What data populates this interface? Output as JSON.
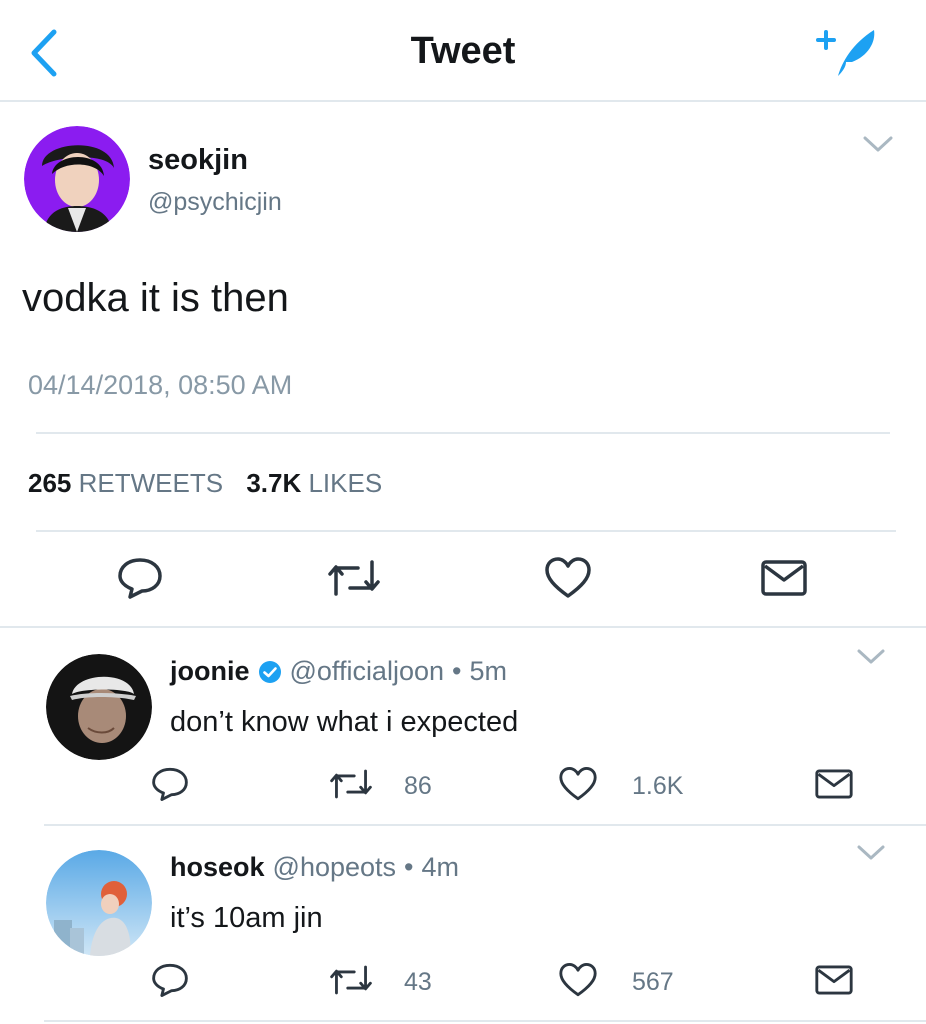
{
  "header": {
    "title": "Tweet",
    "back_icon": "chevron-left-icon",
    "compose_icon": "compose-tweet-icon"
  },
  "colors": {
    "accent": "#1da1f2",
    "text": "#14171a",
    "muted": "#657786",
    "divider": "#e1e8ed",
    "avatar_bg_purple": "#8b1cf0"
  },
  "tweet": {
    "name": "seokjin",
    "handle": "@psychicjin",
    "text": "vodka it is then",
    "timestamp": "04/14/2018, 08:50 AM",
    "retweets_count": "265",
    "retweets_label": "RETWEETS",
    "likes_count": "3.7K",
    "likes_label": "LIKES",
    "actions": [
      "reply-icon",
      "retweet-icon",
      "like-icon",
      "message-icon"
    ]
  },
  "replies": [
    {
      "name": "joonie",
      "verified": true,
      "handle": "@officialjoon",
      "time": "5m",
      "text": "don’t know what i expected",
      "retweets": "86",
      "likes": "1.6K"
    },
    {
      "name": "hoseok",
      "verified": false,
      "handle": "@hopeots",
      "time": "4m",
      "text": "it’s 10am jin",
      "retweets": "43",
      "likes": "567"
    }
  ]
}
